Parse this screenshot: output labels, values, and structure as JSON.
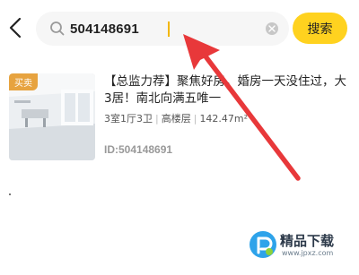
{
  "search": {
    "query": "504148691",
    "button_label": "搜索"
  },
  "listing": {
    "badge": "买卖",
    "title": "【总监力荐】聚焦好房，婚房一天没住过，大3居！南北向满五唯一",
    "specs": [
      "3室1厅3卫",
      "高楼层",
      "142.47m²"
    ],
    "id_text": "ID:504148691"
  },
  "watermark": {
    "brand": "精品下载",
    "url": "www.jpxz.com"
  },
  "colors": {
    "accent_yellow": "#ffd21f",
    "badge_orange": "#e7a33f",
    "arrow_red": "#e8383a"
  }
}
